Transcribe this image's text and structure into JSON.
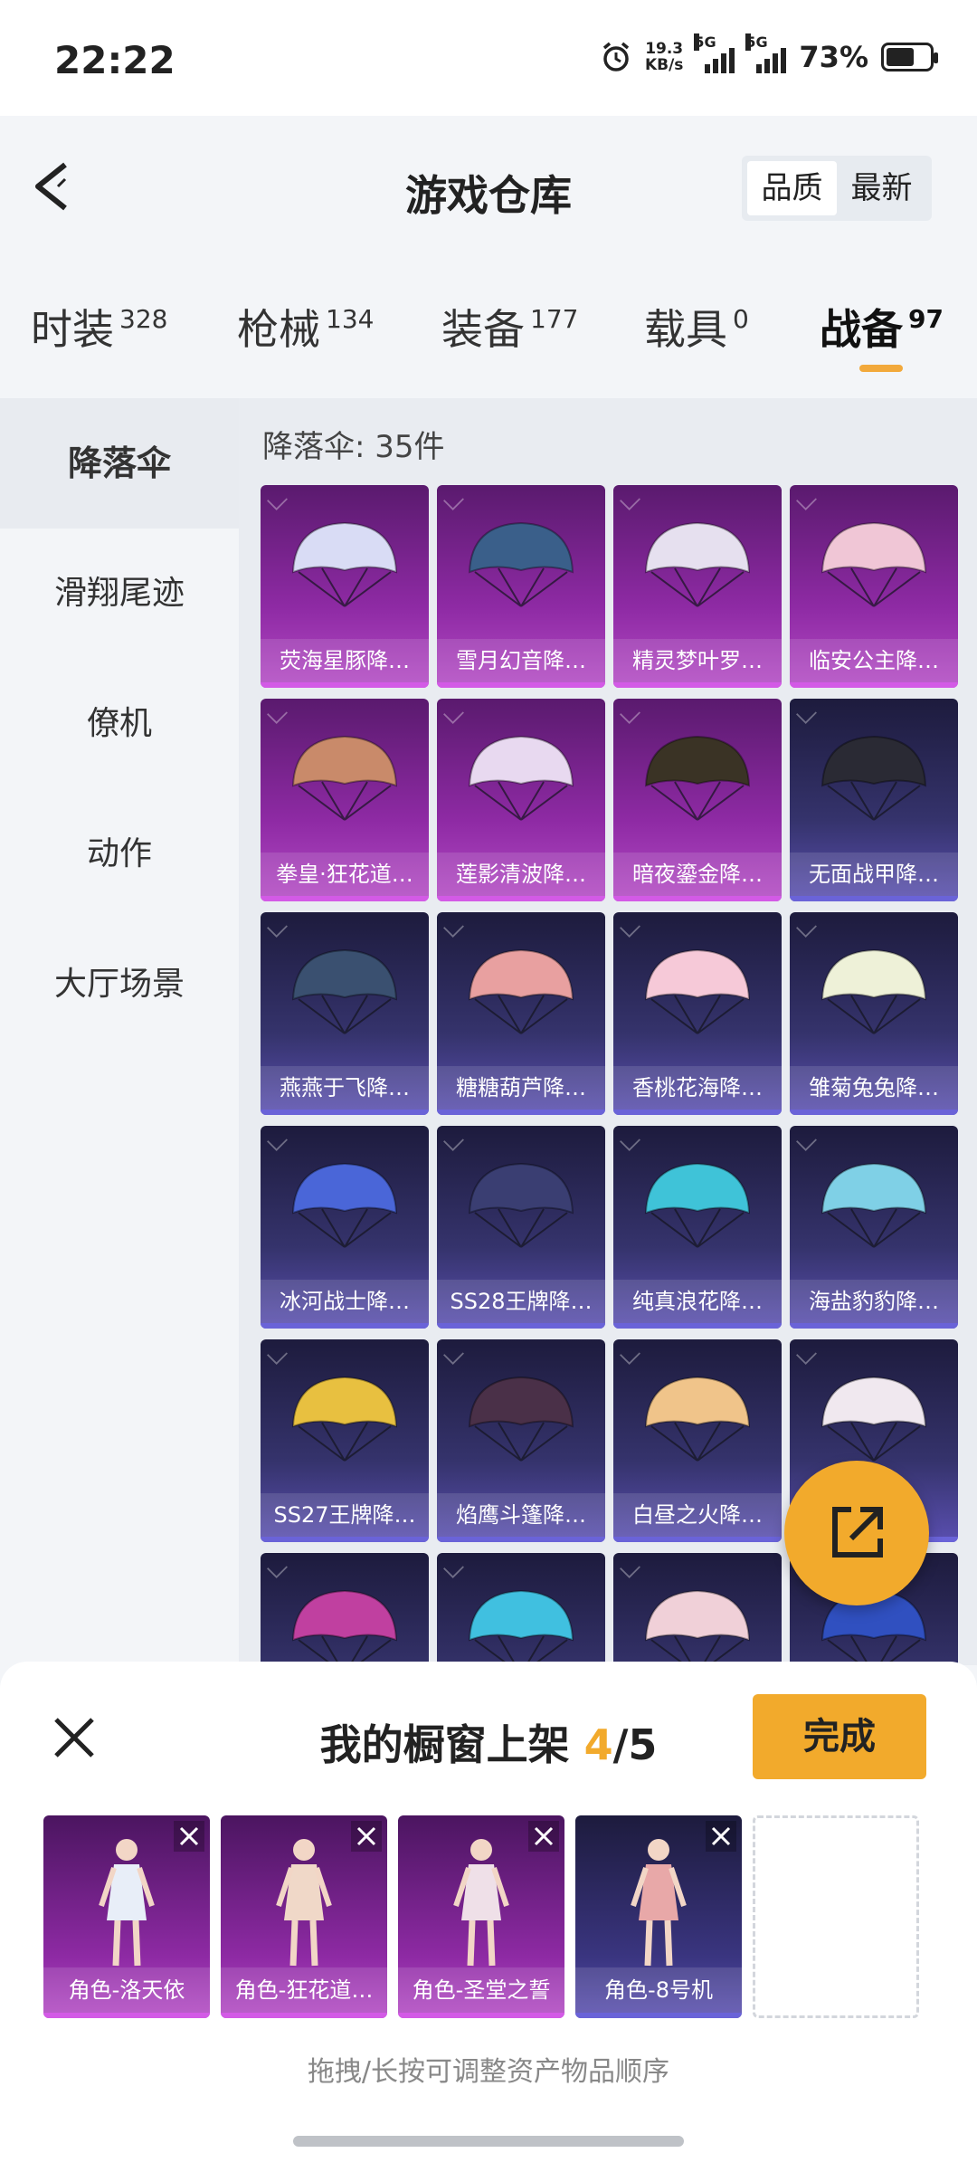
{
  "status": {
    "time": "22:22",
    "speed_value": "19.3",
    "speed_unit": "KB/s",
    "sig1": "5G",
    "sig2": "5G",
    "battery": "73%"
  },
  "header": {
    "title": "游戏仓库",
    "sort_options": [
      "品质",
      "最新"
    ],
    "sort_selected": "品质"
  },
  "tabs": [
    {
      "label": "时装",
      "count": "328"
    },
    {
      "label": "枪械",
      "count": "134"
    },
    {
      "label": "装备",
      "count": "177"
    },
    {
      "label": "载具",
      "count": "0"
    },
    {
      "label": "战备",
      "count": "97",
      "active": true
    }
  ],
  "sidebar": [
    "降落伞",
    "滑翔尾迹",
    "僚机",
    "动作",
    "大厅场景"
  ],
  "content": {
    "count_text": "降落伞: 35件"
  },
  "items": [
    {
      "label": "荧海星豚降…",
      "tier": "purple",
      "color": "#d9dcf5"
    },
    {
      "label": "雪月幻音降…",
      "tier": "purple",
      "color": "#3a5f8a"
    },
    {
      "label": "精灵梦叶罗…",
      "tier": "purple",
      "color": "#e6e0ef"
    },
    {
      "label": "临安公主降…",
      "tier": "purple",
      "color": "#f0c6d6"
    },
    {
      "label": "拳皇·狂花道…",
      "tier": "purple",
      "color": "#c98a6a"
    },
    {
      "label": "莲影清波降…",
      "tier": "purple",
      "color": "#e8d9f0"
    },
    {
      "label": "暗夜鎏金降…",
      "tier": "purple",
      "color": "#3a3325"
    },
    {
      "label": "无面战甲降…",
      "tier": "blue",
      "color": "#2a2a34"
    },
    {
      "label": "燕燕于飞降…",
      "tier": "blue",
      "color": "#3a5070"
    },
    {
      "label": "糖糖葫芦降…",
      "tier": "blue",
      "color": "#e8a0a0"
    },
    {
      "label": "香桃花海降…",
      "tier": "blue",
      "color": "#f6c9d8"
    },
    {
      "label": "雏菊兔兔降…",
      "tier": "blue",
      "color": "#eef1d8"
    },
    {
      "label": "冰河战士降…",
      "tier": "blue",
      "color": "#4a66d8"
    },
    {
      "label": "SS28王牌降…",
      "tier": "blue",
      "color": "#3a3e72"
    },
    {
      "label": "纯真浪花降…",
      "tier": "blue",
      "color": "#3fc3d8"
    },
    {
      "label": "海盐豹豹降…",
      "tier": "blue",
      "color": "#7fd0e6"
    },
    {
      "label": "SS27王牌降…",
      "tier": "blue",
      "color": "#e8c040"
    },
    {
      "label": "焰鹰斗篷降…",
      "tier": "blue",
      "color": "#4a3048"
    },
    {
      "label": "白昼之火降…",
      "tier": "blue",
      "color": "#f0c48a"
    },
    {
      "label": "",
      "tier": "blue",
      "color": "#f0e8ef"
    },
    {
      "label": "",
      "tier": "blue",
      "color": "#c040a0"
    },
    {
      "label": "",
      "tier": "blue",
      "color": "#40c0e0"
    },
    {
      "label": "",
      "tier": "blue",
      "color": "#f0d0d8"
    },
    {
      "label": "",
      "tier": "blue",
      "color": "#3050c0"
    }
  ],
  "sheet": {
    "title_prefix": "我的橱窗上架",
    "current": "4",
    "total_text": "/5",
    "done_label": "完成",
    "hint": "拖拽/长按可调整资产物品顺序",
    "slots": [
      {
        "label": "角色-洛天依",
        "tier": "purple"
      },
      {
        "label": "角色-狂花道…",
        "tier": "purple"
      },
      {
        "label": "角色-圣堂之誓",
        "tier": "purple"
      },
      {
        "label": "角色-8号机",
        "tier": "blue"
      },
      {
        "label": "",
        "tier": "empty"
      }
    ]
  }
}
